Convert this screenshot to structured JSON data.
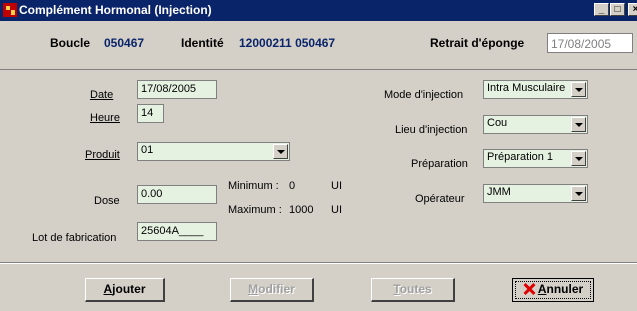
{
  "window": {
    "title": "Complément Hormonal  (Injection)",
    "controls": {
      "minimize": "_",
      "maximize": "□",
      "close": "×"
    }
  },
  "header": {
    "boucle_label": "Boucle",
    "boucle_value": "050467",
    "identite_label": "Identité",
    "identite_value": "12000211 050467",
    "retrait_label": "Retrait d'éponge",
    "retrait_value": "17/08/2005"
  },
  "form": {
    "date_label": "Date",
    "date_value": "17/08/2005",
    "heure_label": "Heure",
    "heure_value": "14",
    "produit_label": "Produit",
    "produit_value": "01",
    "dose_label": "Dose",
    "dose_value": "0.00",
    "minimum_label": "Minimum :",
    "minimum_value": "0",
    "minimum_unit": "UI",
    "maximum_label": "Maximum :",
    "maximum_value": "1000",
    "maximum_unit": "UI",
    "lot_label": "Lot de fabrication",
    "lot_value": "25604A____",
    "mode_label": "Mode d'injection",
    "mode_value": "Intra Musculaire",
    "lieu_label": "Lieu d'injection",
    "lieu_value": "Cou",
    "preparation_label": "Préparation",
    "preparation_value": "Préparation 1",
    "operateur_label": "Opérateur",
    "operateur_value": "JMM"
  },
  "buttons": {
    "ajouter_mn": "A",
    "ajouter_rest": "jouter",
    "modifier_mn": "M",
    "modifier_rest": "odifier",
    "toutes_mn": "T",
    "toutes_rest": "outes",
    "annuler_mn": "A",
    "annuler_rest": "nnuler"
  },
  "colors": {
    "titlebar": "#0a246a",
    "window_bg": "#d4d0c8",
    "field_bg": "#e6f2e1",
    "header_value": "#0a246a"
  },
  "icons": [
    "app-icon",
    "minimize-icon",
    "maximize-icon",
    "close-icon",
    "chevron-down-icon",
    "cancel-x-icon"
  ]
}
